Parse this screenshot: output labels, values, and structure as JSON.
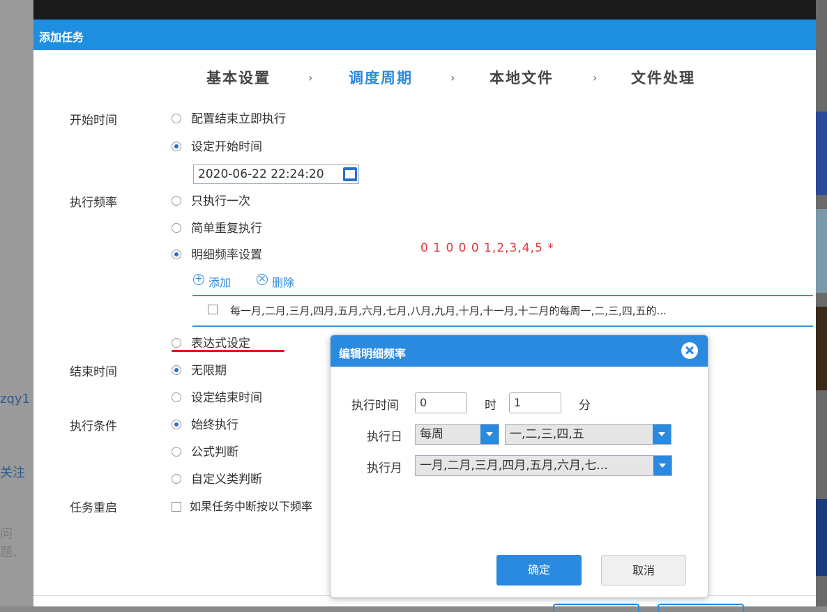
{
  "dialog_title": "添加任务",
  "steps": [
    "基本设置",
    "调度周期",
    "本地文件",
    "文件处理"
  ],
  "step_separator": "›",
  "active_step": 1,
  "labels": {
    "start_time": "开始时间",
    "exec_freq": "执行频率",
    "end_time": "结束时间",
    "exec_cond": "执行条件",
    "task_restart": "任务重启"
  },
  "start_options": [
    "配置结束立即执行",
    "设定开始时间"
  ],
  "start_datetime": "2020-06-22 22:24:20",
  "freq_options": [
    "只执行一次",
    "简单重复执行",
    "明细频率设置"
  ],
  "cron_expression": "0 1 0 0 0 1,2,3,4,5 *",
  "add_label": "添加",
  "delete_label": "删除",
  "freq_row": "每一月,二月,三月,四月,五月,六月,七月,八月,九月,十月,十一月,十二月的每周一,二,三,四,五的...",
  "expr_option": "表达式设定",
  "end_options": [
    "无限期",
    "设定结束时间"
  ],
  "cond_options": [
    "始终执行",
    "公式判断",
    "自定义类判断"
  ],
  "restart_text": "如果任务中断按以下频率",
  "background": {
    "left_text_1": "zqy1",
    "left_text_2": "关注",
    "left_text_3": "问题、"
  },
  "modal": {
    "title": "编辑明细频率",
    "exec_time_label": "执行时间",
    "hour_value": "0",
    "hour_unit": "时",
    "minute_value": "1",
    "minute_unit": "分",
    "exec_day_label": "执行日",
    "day_type": "每周",
    "days_value": "一,二,三,四,五",
    "exec_month_label": "执行月",
    "months_value": "一月,二月,三月,四月,五月,六月,七...",
    "ok": "确定",
    "cancel": "取消"
  },
  "colors": {
    "accent": "#2a8adf",
    "title_bar": "#1e8fe0",
    "cron_text": "#e4383b",
    "annotation_underline": "#e01a1a"
  }
}
